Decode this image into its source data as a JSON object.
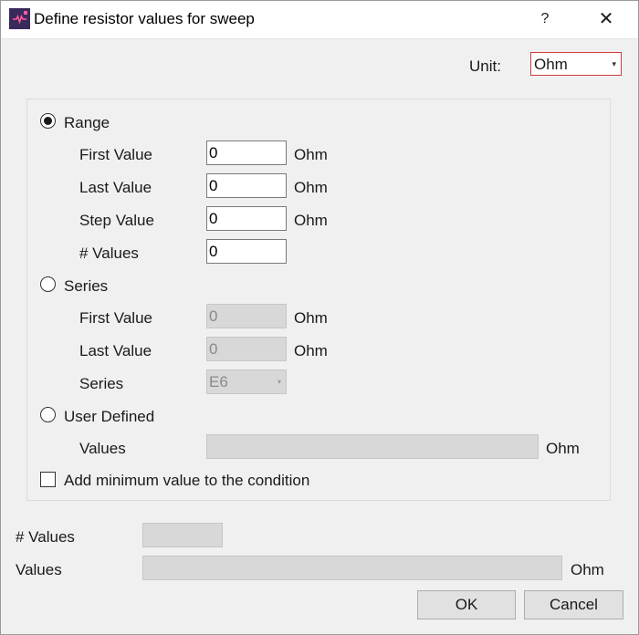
{
  "window": {
    "title": "Define resistor values for sweep",
    "help": "?",
    "close": "✕"
  },
  "unit": {
    "label": "Unit:",
    "value": "Ohm"
  },
  "range": {
    "label": "Range",
    "selected": true,
    "first_label": "First Value",
    "first_value": "0",
    "first_unit": "Ohm",
    "last_label": "Last Value",
    "last_value": "0",
    "last_unit": "Ohm",
    "step_label": "Step Value",
    "step_value": "0",
    "step_unit": "Ohm",
    "count_label": "# Values",
    "count_value": "0"
  },
  "series": {
    "label": "Series",
    "selected": false,
    "first_label": "First Value",
    "first_value": "0",
    "first_unit": "Ohm",
    "last_label": "Last Value",
    "last_value": "0",
    "last_unit": "Ohm",
    "series_label": "Series",
    "series_value": "E6"
  },
  "user_defined": {
    "label": "User Defined",
    "selected": false,
    "values_label": "Values",
    "values_value": "",
    "values_unit": "Ohm"
  },
  "add_min": {
    "label": "Add minimum value to the condition",
    "checked": false
  },
  "summary": {
    "count_label": "# Values",
    "count_value": "",
    "values_label": "Values",
    "values_value": "",
    "values_unit": "Ohm"
  },
  "buttons": {
    "ok": "OK",
    "cancel": "Cancel"
  }
}
